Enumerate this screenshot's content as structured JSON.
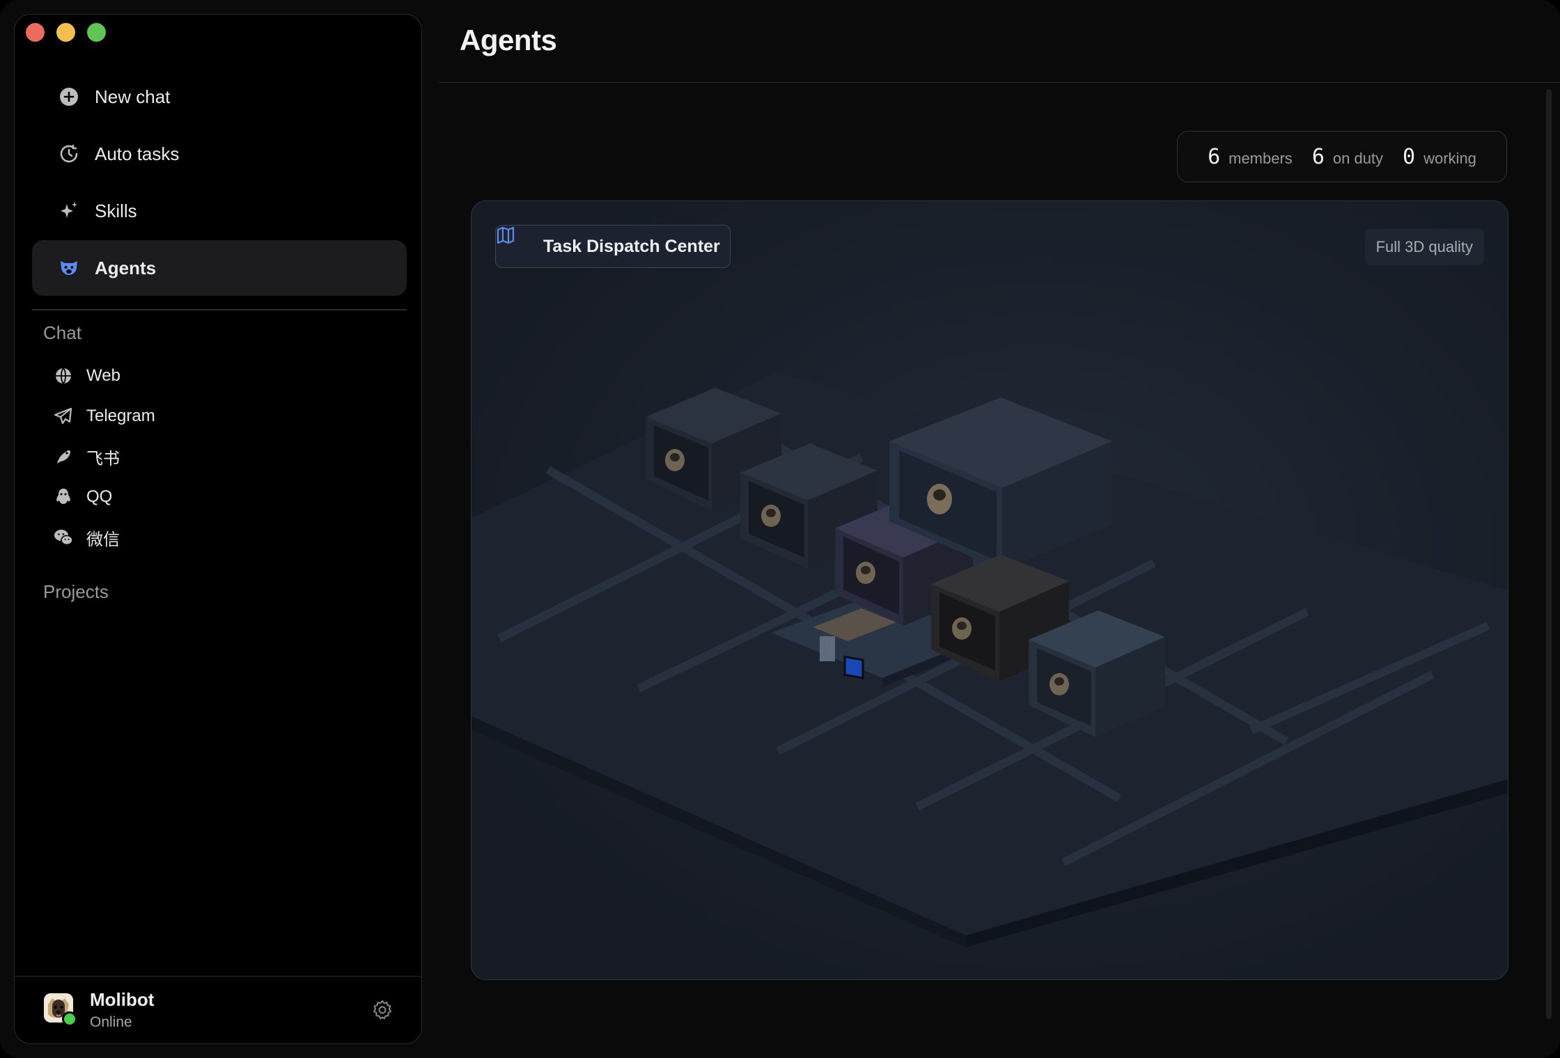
{
  "window": {
    "controls": [
      "close",
      "minimize",
      "zoom"
    ]
  },
  "sidebar": {
    "nav": [
      {
        "label": "New chat",
        "icon": "plus-circle-icon"
      },
      {
        "label": "Auto tasks",
        "icon": "clock-cycle-icon"
      },
      {
        "label": "Skills",
        "icon": "sparkle-icon"
      },
      {
        "label": "Agents",
        "icon": "pug-icon",
        "active": true
      }
    ],
    "chat_section": "Chat",
    "chat_channels": [
      {
        "label": "Web",
        "icon": "globe-icon"
      },
      {
        "label": "Telegram",
        "icon": "paper-plane-icon"
      },
      {
        "label": "飞书",
        "icon": "feishu-bird-icon"
      },
      {
        "label": "QQ",
        "icon": "qq-penguin-icon"
      },
      {
        "label": "微信",
        "icon": "wechat-icon"
      }
    ],
    "projects_section": "Projects",
    "user": {
      "name": "Molibot",
      "status": "Online"
    }
  },
  "main": {
    "title": "Agents",
    "stats": [
      {
        "value": "6",
        "label": "members"
      },
      {
        "value": "6",
        "label": "on duty"
      },
      {
        "value": "0",
        "label": "working"
      }
    ],
    "stage": {
      "dispatch_label": "Task Dispatch Center",
      "quality_label": "Full 3D quality"
    }
  },
  "colors": {
    "accent": "#5b8cf0",
    "online": "#4ccd4c",
    "stage_bg": "#1a1f29"
  }
}
